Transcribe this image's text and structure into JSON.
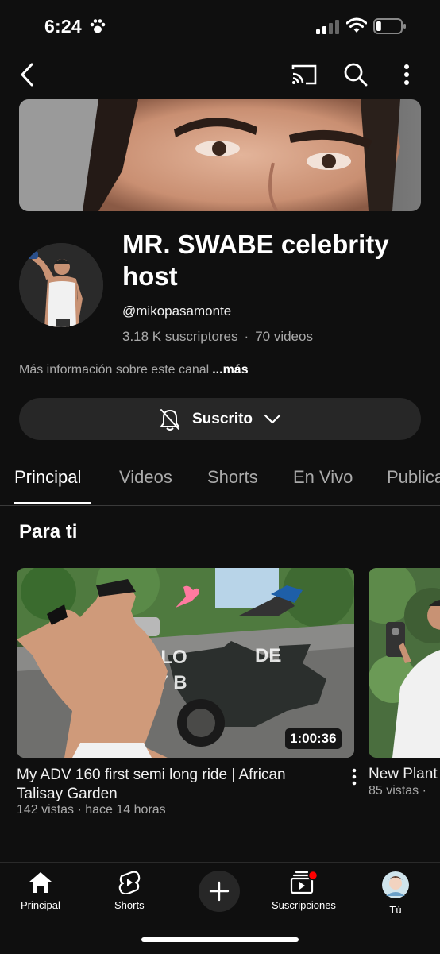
{
  "status_bar": {
    "time": "6:24",
    "battery_level": 0.2
  },
  "channel": {
    "name": "MR. SWABE celebrity host",
    "handle": "@mikopasamonte",
    "subscribers": "3.18 K suscriptores",
    "videos": "70 videos",
    "about": "Más información sobre este canal",
    "about_more": "...más"
  },
  "subscribe": {
    "label": "Suscrito"
  },
  "tabs": [
    {
      "label": "Principal",
      "active": true
    },
    {
      "label": "Videos"
    },
    {
      "label": "Shorts"
    },
    {
      "label": "En Vivo"
    },
    {
      "label": "Publicaciones"
    }
  ],
  "section": {
    "title": "Para ti"
  },
  "videos": [
    {
      "title": "My ADV 160 first semi long ride | African Talisay Garden",
      "meta": "142 vistas · hace 14 horas",
      "duration": "1:00:36"
    },
    {
      "title": "New Plant",
      "meta": "85 vistas ·"
    }
  ],
  "bottom_nav": [
    {
      "label": "Principal",
      "icon": "home-icon"
    },
    {
      "label": "Shorts",
      "icon": "shorts-icon"
    },
    {
      "label": "",
      "icon": "create-icon"
    },
    {
      "label": "Suscripciones",
      "icon": "subscriptions-icon"
    },
    {
      "label": "Tú",
      "icon": "avatar-icon"
    }
  ],
  "colors": {
    "background": "#0f0f0f",
    "button": "#272727",
    "secondary_text": "#aaaaaa",
    "notification": "#ff0000"
  }
}
